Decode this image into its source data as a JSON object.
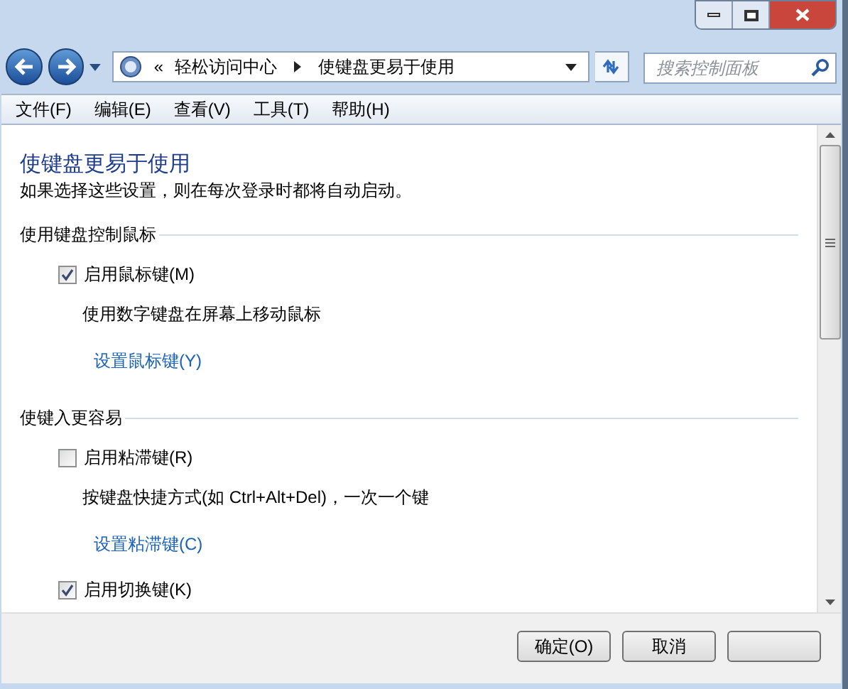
{
  "address_bar": {
    "overflow": "«",
    "crumbs": [
      "轻松访问中心",
      "使键盘更易于使用"
    ]
  },
  "search": {
    "placeholder": "搜索控制面板"
  },
  "menu": [
    "文件(F)",
    "编辑(E)",
    "查看(V)",
    "工具(T)",
    "帮助(H)"
  ],
  "page": {
    "title": "使键盘更易于使用",
    "subtitle": "如果选择这些设置，则在每次登录时都将自动启动。"
  },
  "sections": [
    {
      "heading": "使用键盘控制鼠标",
      "options": [
        {
          "label": "启用鼠标键(M)",
          "checked": true,
          "description": "使用数字键盘在屏幕上移动鼠标",
          "link": "设置鼠标键(Y)"
        }
      ]
    },
    {
      "heading": "使键入更容易",
      "options": [
        {
          "label": "启用粘滞键(R)",
          "checked": false,
          "description": "按键盘快捷方式(如 Ctrl+Alt+Del)，一次一个键",
          "link": "设置粘滞键(C)"
        },
        {
          "label": "启用切换键(K)",
          "checked": true
        }
      ]
    }
  ],
  "buttons": [
    "确定(O)",
    "取消"
  ]
}
